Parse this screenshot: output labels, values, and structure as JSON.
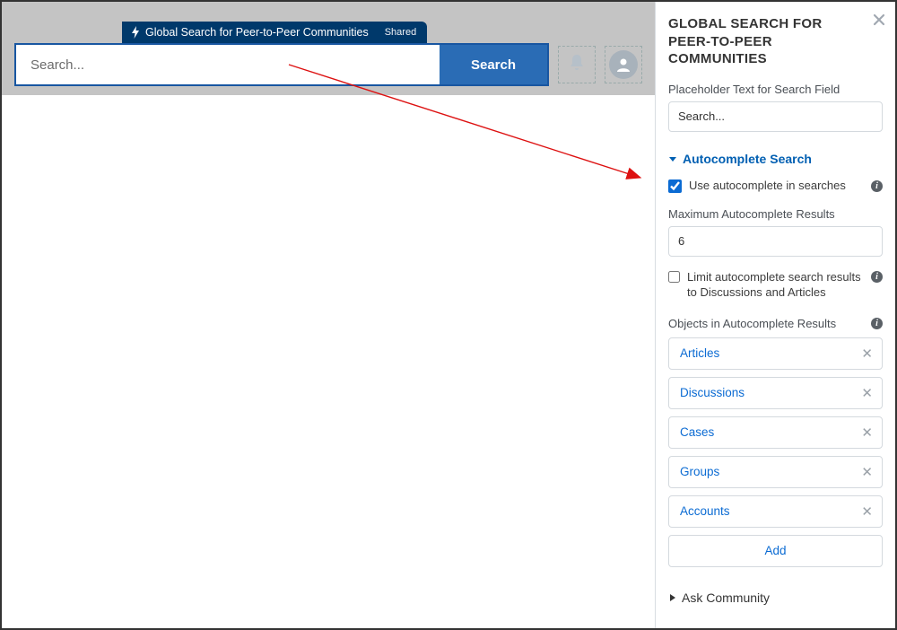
{
  "preview": {
    "component_tab": {
      "label": "Global Search for Peer-to-Peer Communities",
      "badge": "Shared"
    },
    "search_placeholder": "Search...",
    "search_button": "Search"
  },
  "panel": {
    "title": "GLOBAL SEARCH FOR PEER-TO-PEER COMMUNITIES",
    "placeholder_label": "Placeholder Text for Search Field",
    "placeholder_value": "Search...",
    "autocomplete_section": "Autocomplete Search",
    "use_autocomplete_label": "Use autocomplete in searches",
    "use_autocomplete_checked": true,
    "max_results_label": "Maximum Autocomplete Results",
    "max_results_value": "6",
    "limit_label": "Limit autocomplete search results to Discussions and Articles",
    "limit_checked": false,
    "objects_label": "Objects in Autocomplete Results",
    "objects": [
      "Articles",
      "Discussions",
      "Cases",
      "Groups",
      "Accounts"
    ],
    "add_label": "Add",
    "ask_label": "Ask Community"
  }
}
